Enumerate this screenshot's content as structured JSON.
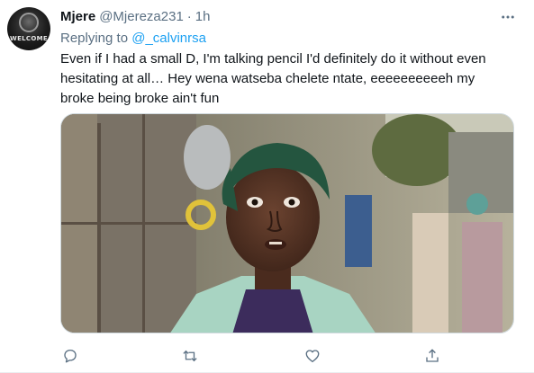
{
  "tweet": {
    "author_name": "Mjere",
    "author_handle": "@Mjereza231",
    "separator": "·",
    "time": "1h",
    "replying_label": "Replying to",
    "replying_to": "@_calvinrsa",
    "text": "Even if I had a small D, I'm talking pencil I'd definitely do it without even hesitating at all… Hey wena watseba chelete ntate, eeeeeeeeeeh my broke being broke ain't fun",
    "avatar_text": "WELCOME"
  },
  "icons": {
    "more": "more-icon",
    "reply": "reply-icon",
    "retweet": "retweet-icon",
    "like": "like-icon",
    "share": "share-icon"
  },
  "colors": {
    "text_primary": "#0f1419",
    "text_secondary": "#5b7083",
    "link": "#1da1f2",
    "border": "#cfd9de"
  }
}
